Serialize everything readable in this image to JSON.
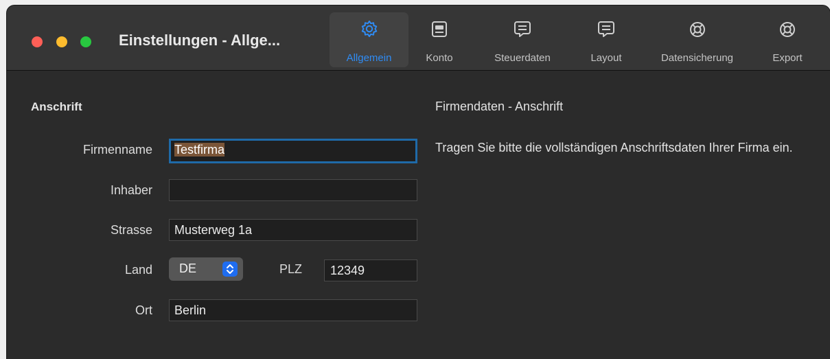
{
  "window": {
    "title": "Einstellungen - Allge..."
  },
  "toolbar": {
    "items": [
      {
        "label": "Allgemein",
        "icon": "gear-icon",
        "active": true
      },
      {
        "label": "Konto",
        "icon": "account-card-icon",
        "active": false
      },
      {
        "label": "Steuerdaten",
        "icon": "speech-bubble-icon",
        "active": false
      },
      {
        "label": "Layout",
        "icon": "speech-bubble-icon",
        "active": false
      },
      {
        "label": "Datensicherung",
        "icon": "lifebuoy-icon",
        "active": false
      },
      {
        "label": "Export",
        "icon": "lifebuoy-icon",
        "active": false
      }
    ]
  },
  "form": {
    "section_title": "Anschrift",
    "firmenname": {
      "label": "Firmenname",
      "value": "Testfirma"
    },
    "inhaber": {
      "label": "Inhaber",
      "value": ""
    },
    "strasse": {
      "label": "Strasse",
      "value": "Musterweg 1a"
    },
    "land": {
      "label": "Land",
      "value": "DE"
    },
    "plz": {
      "label": "PLZ",
      "value": "12349"
    },
    "ort": {
      "label": "Ort",
      "value": "Berlin"
    }
  },
  "info": {
    "title": "Firmendaten - Anschrift",
    "text": "Tragen Sie bitte die vollständigen Anschriftsdaten Ihrer Firma ein."
  },
  "colors": {
    "accent": "#2f8cf5",
    "close": "#fe5f57",
    "minimize": "#febc2e",
    "maximize": "#28c840",
    "selection": "#7a5538"
  }
}
